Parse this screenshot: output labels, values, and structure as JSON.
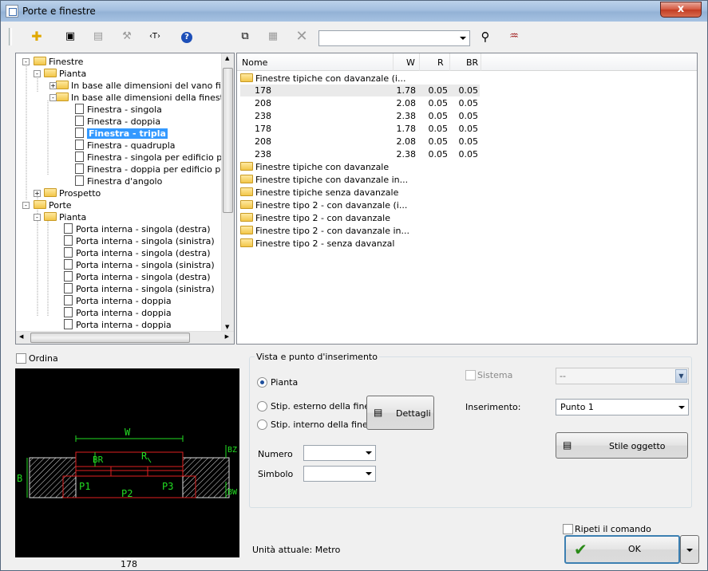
{
  "window": {
    "title": "Porte e finestre",
    "close_label": "x"
  },
  "toolbar": {
    "search_value": ""
  },
  "tree": [
    {
      "label": "Finestre",
      "type": "folder",
      "exp": "-"
    },
    {
      "label": "Pianta",
      "type": "folder",
      "exp": "-"
    },
    {
      "label": "In base alle dimensioni del vano finestra",
      "type": "folder",
      "exp": "+"
    },
    {
      "label": "In base alle dimensioni della finestra",
      "type": "folder",
      "exp": "-"
    },
    {
      "label": "Finestra - singola",
      "type": "doc"
    },
    {
      "label": "Finestra - doppia",
      "type": "doc"
    },
    {
      "label": "Finestra - tripla",
      "type": "doc",
      "selected": true
    },
    {
      "label": "Finestra - quadrupla",
      "type": "doc"
    },
    {
      "label": "Finestra - singola per edificio pubblico",
      "type": "doc"
    },
    {
      "label": "Finestra - doppia per edificio pubblico",
      "type": "doc"
    },
    {
      "label": "Finestra d'angolo",
      "type": "doc"
    },
    {
      "label": "Prospetto",
      "type": "folder",
      "exp": "+"
    },
    {
      "label": "Porte",
      "type": "folder",
      "exp": "-"
    },
    {
      "label": "Pianta",
      "type": "folder",
      "exp": "-"
    },
    {
      "label": "Porta interna - singola (destra)",
      "type": "doc"
    },
    {
      "label": "Porta interna - singola (sinistra)",
      "type": "doc"
    },
    {
      "label": "Porta interna - singola (destra)",
      "type": "doc"
    },
    {
      "label": "Porta interna - singola (sinistra)",
      "type": "doc"
    },
    {
      "label": "Porta interna - singola (destra)",
      "type": "doc"
    },
    {
      "label": "Porta interna - singola (sinistra)",
      "type": "doc"
    },
    {
      "label": "Porta interna - doppia",
      "type": "doc"
    },
    {
      "label": "Porta interna - doppia",
      "type": "doc"
    },
    {
      "label": "Porta interna - doppia",
      "type": "doc"
    }
  ],
  "list": {
    "columns": [
      "Nome",
      "W",
      "R",
      "BR"
    ],
    "open_folder": "Finestre tipiche con davanzale (i...",
    "rows": [
      {
        "name": "178",
        "w": "1.78",
        "r": "0.05",
        "br": "0.05"
      },
      {
        "name": "208",
        "w": "2.08",
        "r": "0.05",
        "br": "0.05"
      },
      {
        "name": "238",
        "w": "2.38",
        "r": "0.05",
        "br": "0.05"
      },
      {
        "name": "178",
        "w": "1.78",
        "r": "0.05",
        "br": "0.05"
      },
      {
        "name": "208",
        "w": "2.08",
        "r": "0.05",
        "br": "0.05"
      },
      {
        "name": "238",
        "w": "2.38",
        "r": "0.05",
        "br": "0.05"
      }
    ],
    "folders": [
      "Finestre tipiche con davanzale",
      "Finestre tipiche con davanzale in...",
      "Finestre tipiche senza davanzale",
      "Finestre tipo 2 - con davanzale (i...",
      "Finestre tipo 2 - con davanzale",
      "Finestre tipo 2 - con davanzale in...",
      "Finestre tipo 2 - senza davanzal"
    ]
  },
  "ordina_label": "Ordina",
  "preview": {
    "caption": "178",
    "label_w": "W",
    "label_b": "B",
    "label_br": "BR",
    "label_r": "R",
    "label_p1": "P1",
    "label_p2": "P2",
    "label_p3": "P3",
    "label_bz": "BZ",
    "label_bw": "BW"
  },
  "group": {
    "title": "Vista e punto d'inserimento",
    "radio_pianta": "Pianta",
    "radio_esterno": "Stip. esterno della finestra",
    "radio_interno": "Stip. interno della finestra",
    "dettagli_button": "Dettagli",
    "numero_label": "Numero",
    "simbolo_label": "Simbolo",
    "sistema_label": "Sistema",
    "sistema_value": "--",
    "inserimento_label": "Inserimento:",
    "inserimento_value": "Punto 1",
    "stile_button": "Stile oggetto"
  },
  "ripeti_label": "Ripeti il comando",
  "unita_label": "Unità attuale: Metro",
  "ok_label": "OK"
}
